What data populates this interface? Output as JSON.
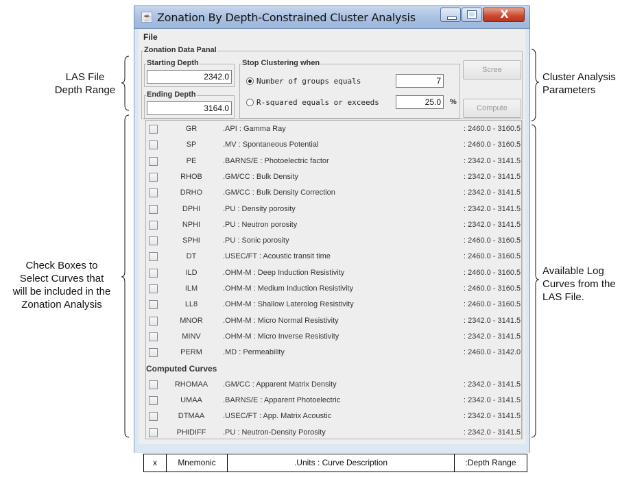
{
  "window": {
    "title": "Zonation By Depth-Constrained Cluster Analysis",
    "app_icon": "java-cup-icon",
    "controls": [
      "minimize-icon",
      "maximize-icon",
      "close-icon"
    ],
    "close_glyph": "X"
  },
  "menubar": {
    "file_label": "File"
  },
  "zonation_panel": {
    "title": "Zonation Data Panal",
    "starting_depth": {
      "label": "Starting Depth",
      "value": "2342.0"
    },
    "ending_depth": {
      "label": "Ending Depth",
      "value": "3164.0"
    },
    "stop_clustering": {
      "title": "Stop Clustering when",
      "option_groups": {
        "label": "Number of groups equals",
        "value": "7",
        "selected": true
      },
      "option_rsquared": {
        "label": "R-squared equals or exceeds",
        "value": "25.0",
        "unit": "%",
        "selected": false
      }
    },
    "buttons": {
      "scree": "Scree",
      "compute": "Compute"
    }
  },
  "curves": [
    {
      "mnemonic": "GR",
      "description": ".API : Gamma Ray",
      "range": ": 2460.0 - 3160.5"
    },
    {
      "mnemonic": "SP",
      "description": ".MV : Spontaneous Potential",
      "range": ": 2460.0 - 3160.5"
    },
    {
      "mnemonic": "PE",
      "description": ".BARNS/E : Photoelectric factor",
      "range": ": 2342.0 - 3141.5"
    },
    {
      "mnemonic": "RHOB",
      "description": ".GM/CC : Bulk Density",
      "range": ": 2342.0 - 3141.5"
    },
    {
      "mnemonic": "DRHO",
      "description": ".GM/CC : Bulk Density Correction",
      "range": ": 2342.0 - 3141.5"
    },
    {
      "mnemonic": "DPHI",
      "description": ".PU : Density porosity",
      "range": ": 2342.0 - 3141.5"
    },
    {
      "mnemonic": "NPHI",
      "description": ".PU : Neutron porosity",
      "range": ": 2342.0 - 3141.5"
    },
    {
      "mnemonic": "SPHI",
      "description": ".PU : Sonic porosity",
      "range": ": 2460.0 - 3160.5"
    },
    {
      "mnemonic": "DT",
      "description": ".USEC/FT : Acoustic transit time",
      "range": ": 2460.0 - 3160.5"
    },
    {
      "mnemonic": "ILD",
      "description": ".OHM-M : Deep Induction Resistivity",
      "range": ": 2460.0 - 3160.5"
    },
    {
      "mnemonic": "ILM",
      "description": ".OHM-M : Medium Induction Resistivity",
      "range": ": 2460.0 - 3160.5"
    },
    {
      "mnemonic": "LL8",
      "description": ".OHM-M : Shallow Laterolog Resistivity",
      "range": ": 2460.0 - 3160.5"
    },
    {
      "mnemonic": "MNOR",
      "description": ".OHM-M : Micro Normal Resistivity",
      "range": ": 2342.0 - 3141.5"
    },
    {
      "mnemonic": "MINV",
      "description": ".OHM-M : Micro Inverse Resistivity",
      "range": ": 2342.0 - 3141.5"
    },
    {
      "mnemonic": "PERM",
      "description": ".MD : Permeability",
      "range": ": 2460.0 - 3142.0"
    }
  ],
  "computed_section_label": "Computed Curves",
  "computed_curves": [
    {
      "mnemonic": "RHOMAA",
      "description": ".GM/CC : Apparent Matrix Density",
      "range": ": 2342.0 - 3141.5"
    },
    {
      "mnemonic": "UMAA",
      "description": ".BARNS/E : Apparent Photoelectric",
      "range": ": 2342.0 - 3141.5"
    },
    {
      "mnemonic": "DTMAA",
      "description": ".USEC/FT : App. Matrix Acoustic",
      "range": ": 2342.0 - 3141.5"
    },
    {
      "mnemonic": "PHIDIFF",
      "description": ".PU : Neutron-Density Porosity",
      "range": ": 2342.0 - 3141.5"
    }
  ],
  "annotations": {
    "las_depth": [
      "LAS File",
      "Depth Range"
    ],
    "cluster_params": [
      "Cluster Analysis",
      "Parameters"
    ],
    "check_boxes": [
      "Check Boxes to",
      "Select Curves that",
      "will be included in the",
      "Zonation Analysis"
    ],
    "available_curves": [
      "Available Log",
      "Curves from the",
      "LAS File."
    ]
  },
  "legend": {
    "checkbox_col": "x",
    "mnemonic_col": "Mnemonic",
    "units_col": ".Units : Curve  Description",
    "range_col": ":Depth Range"
  }
}
